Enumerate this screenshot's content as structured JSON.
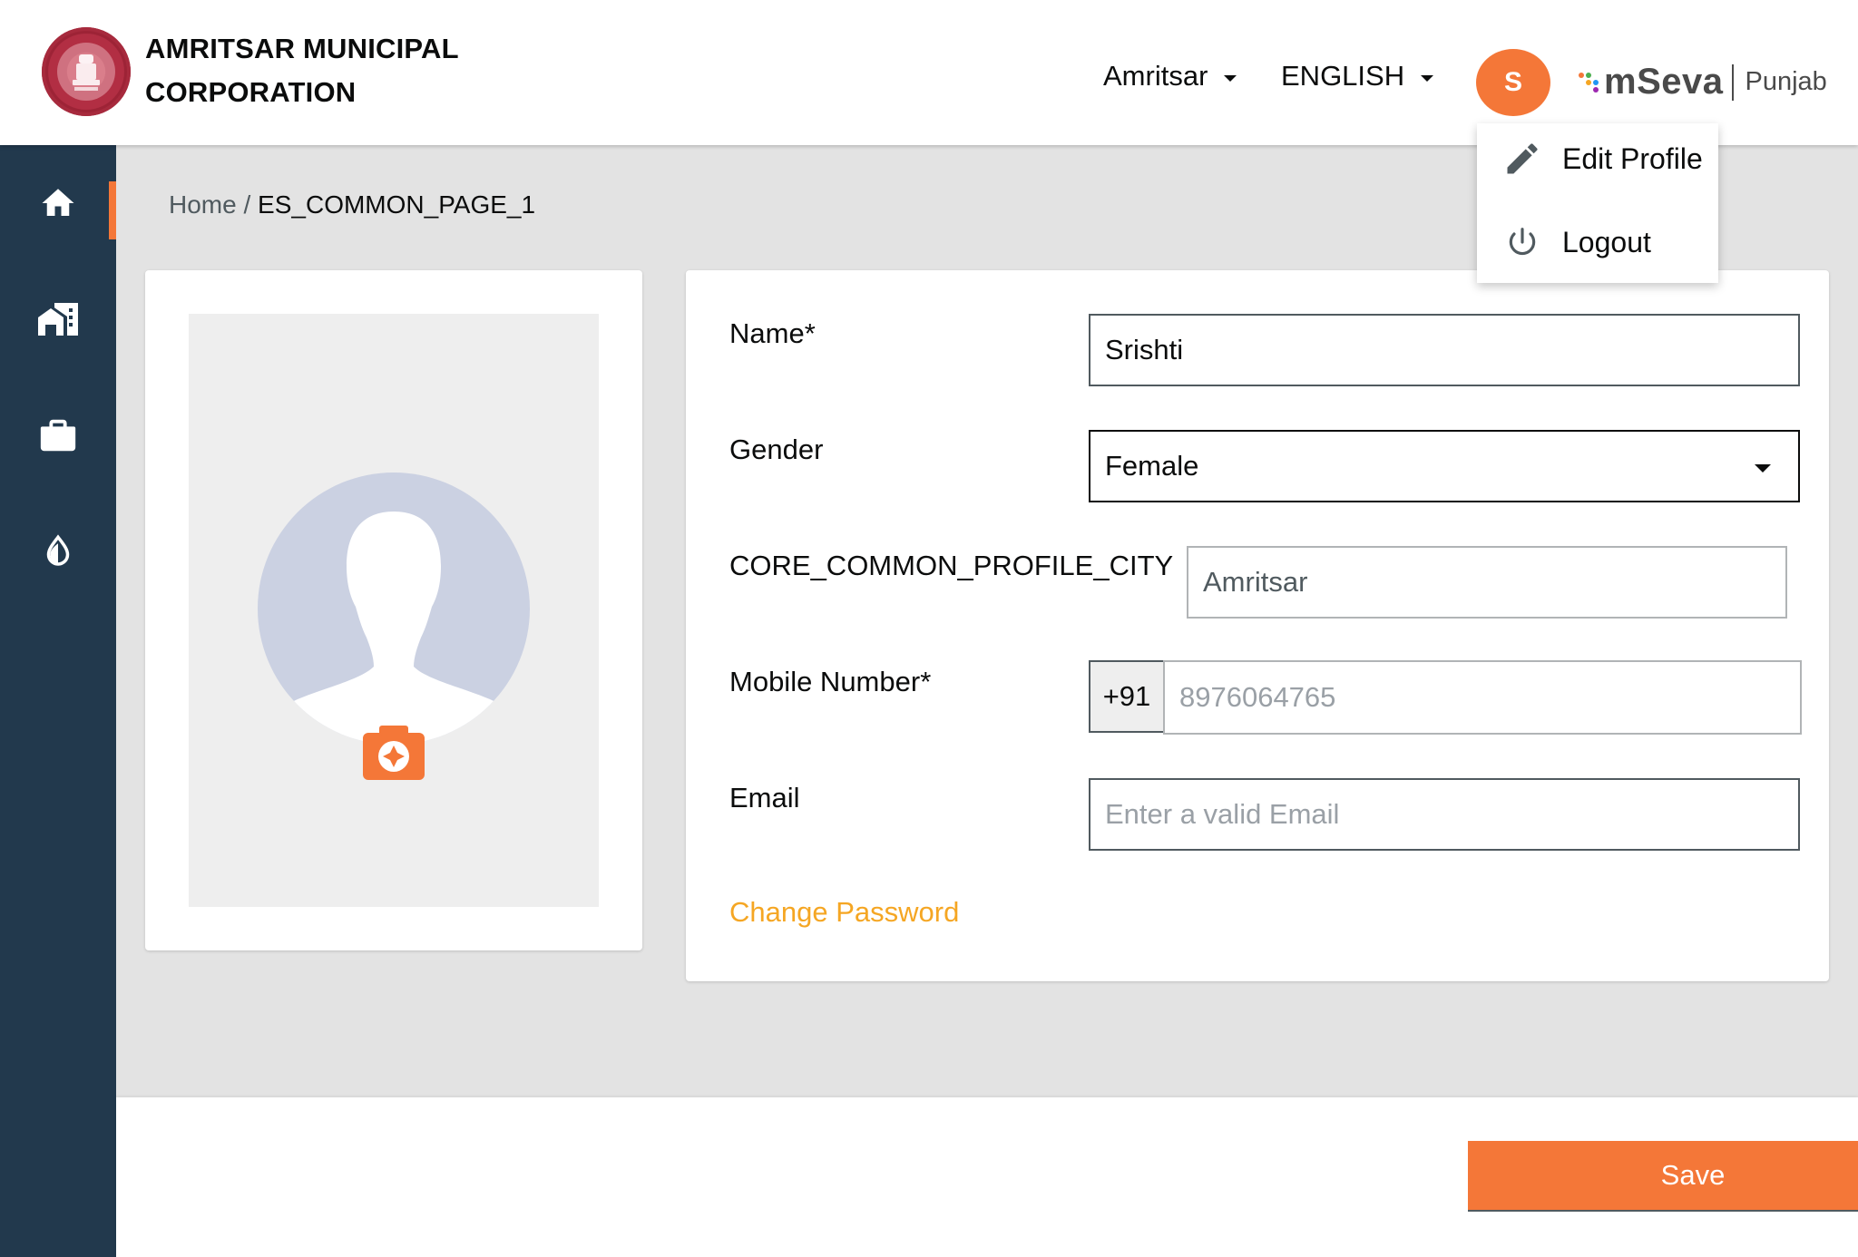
{
  "header": {
    "org_name_line1": "AMRITSAR MUNICIPAL",
    "org_name_line2": "CORPORATION",
    "city_selector": "Amritsar",
    "language_selector": "ENGLISH",
    "avatar_initial": "S",
    "brand_name": "mSeva",
    "brand_state": "Punjab"
  },
  "user_menu": {
    "items": [
      {
        "label": "Edit Profile",
        "icon": "pencil-icon"
      },
      {
        "label": "Logout",
        "icon": "power-icon"
      }
    ]
  },
  "sidebar": {
    "items": [
      {
        "name": "home",
        "icon": "home-icon"
      },
      {
        "name": "property-tax",
        "icon": "building-icon"
      },
      {
        "name": "trade-license",
        "icon": "briefcase-icon"
      },
      {
        "name": "water-sewerage",
        "icon": "water-drop-icon"
      }
    ]
  },
  "breadcrumb": {
    "home": "Home",
    "separator": "/",
    "current": "ES_COMMON_PAGE_1"
  },
  "profile_photo": {
    "camera_icon": "camera-icon"
  },
  "form": {
    "name_label": "Name*",
    "name_value": "Srishti",
    "gender_label": "Gender",
    "gender_value": "Female",
    "city_label": "CORE_COMMON_PROFILE_CITY",
    "city_value": "Amritsar",
    "mobile_label": "Mobile Number*",
    "mobile_prefix": "+91",
    "mobile_value": "8976064765",
    "email_label": "Email",
    "email_value": "",
    "email_placeholder": "Enter a valid Email",
    "change_password": "Change Password"
  },
  "footer": {
    "save_label": "Save"
  },
  "colors": {
    "accent": "#f47738",
    "sidebar": "#22394d",
    "link": "#f5a623"
  }
}
